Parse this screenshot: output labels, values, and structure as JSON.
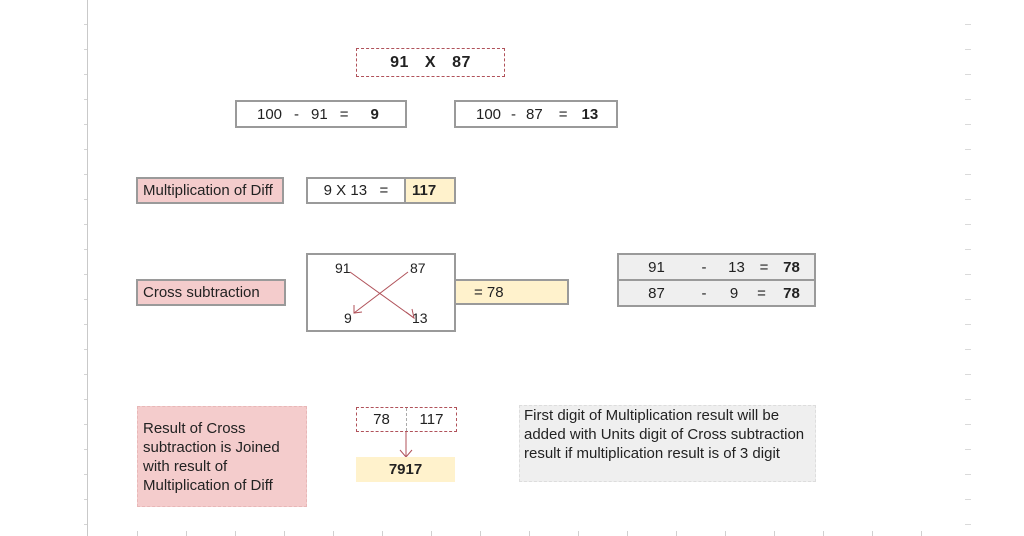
{
  "problem": {
    "a": "91",
    "op": "X",
    "b": "87"
  },
  "differences": [
    {
      "base": "100",
      "minus": "-",
      "num": "91",
      "eq": "=",
      "result": "9"
    },
    {
      "base": "100",
      "minus": "-",
      "num": "87",
      "eq": "=",
      "result": "13"
    }
  ],
  "multiplication": {
    "label": "Multiplication of Diff",
    "expression": "9 X 13   =",
    "result": "117"
  },
  "cross": {
    "label": "Cross subtraction",
    "top_left": "91",
    "top_right": "87",
    "bottom_left": "9",
    "bottom_right": "13",
    "result": "= 78",
    "table": [
      {
        "a": "91",
        "op": "-",
        "b": "13",
        "eq": "=",
        "r": "78"
      },
      {
        "a": "87",
        "op": "-",
        "b": "9",
        "eq": "=",
        "r": "78"
      }
    ]
  },
  "join": {
    "note": "Result of Cross subtraction is Joined with result of Multiplication of Diff",
    "left": "78",
    "right": "117",
    "final": "7917"
  },
  "info": "First digit of Multiplication result will be added with Units digit of Cross subtraction result if multiplication result is of 3 digit",
  "colors": {
    "pink": "#f4cccc",
    "cream": "#fff2cc",
    "grey": "#efefef",
    "arrow": "#b0525a"
  }
}
